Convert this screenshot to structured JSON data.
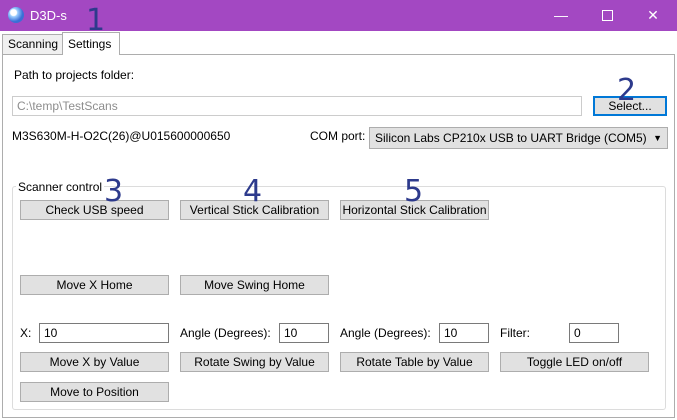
{
  "window": {
    "title": "D3D-s",
    "minimize_glyph": "—",
    "close_glyph": "✕"
  },
  "tabs": [
    {
      "label": "Scanning"
    },
    {
      "label": "Settings"
    }
  ],
  "settings": {
    "path_label": "Path to projects folder:",
    "path_value": "C:\\temp\\TestScans",
    "select_button": "Select...",
    "device_id": "M3S630M-H-O2C(26)@U015600000650",
    "com_port_label": "COM port:",
    "com_port_value": "Silicon Labs CP210x USB to UART Bridge (COM5)",
    "com_port_arrow": "▼"
  },
  "scanner_control": {
    "title": "Scanner control",
    "buttons": {
      "check_usb": "Check USB speed",
      "vertical_cal": "Vertical Stick Calibration",
      "horizontal_cal": "Horizontal Stick Calibration",
      "move_x_home": "Move X Home",
      "move_swing_home": "Move Swing Home",
      "move_x_by_value": "Move X by Value",
      "rotate_swing": "Rotate Swing by Value",
      "rotate_table": "Rotate Table by Value",
      "toggle_led": "Toggle LED on/off",
      "move_to_position": "Move to Position"
    },
    "inputs": {
      "x_label": "X:",
      "x_value": "10",
      "angle_swing_label": "Angle (Degrees):",
      "angle_swing_value": "10",
      "angle_table_label": "Angle (Degrees):",
      "angle_table_value": "10",
      "filter_label": "Filter:",
      "filter_value": "0"
    }
  },
  "annotations": {
    "m1": "1",
    "m2": "2",
    "m3": "3",
    "m4": "4",
    "m5": "5"
  }
}
